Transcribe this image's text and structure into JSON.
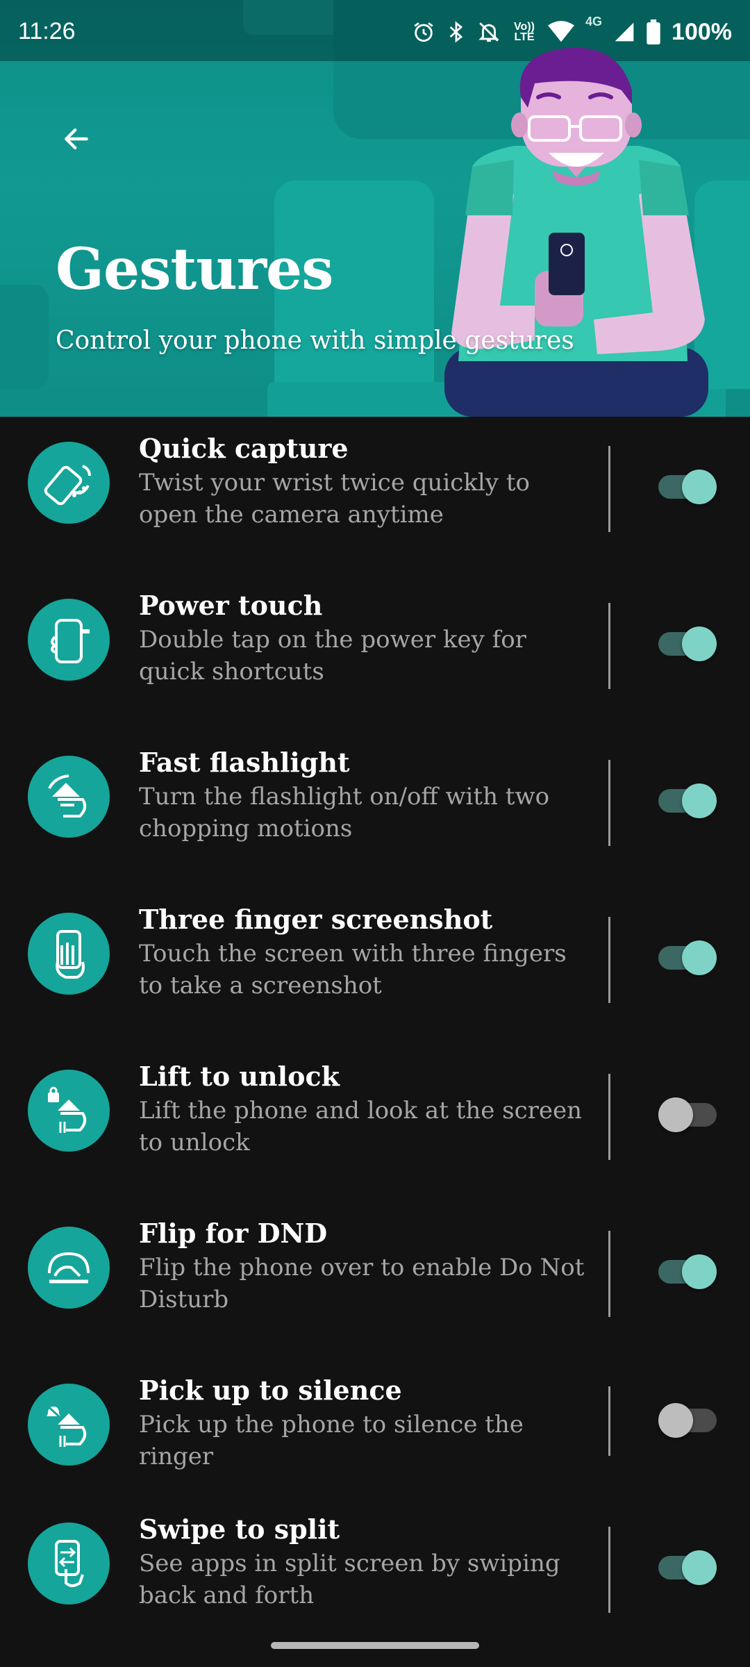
{
  "status": {
    "time": "11:26",
    "volte_label": "Vo)) LTE",
    "network_label": "4G",
    "battery": "100%"
  },
  "header": {
    "title": "Gestures",
    "subtitle": "Control your phone with simple gestures"
  },
  "colors": {
    "accent": "#16a59a",
    "banner": "#109a92",
    "background": "#121212",
    "toggle_on_thumb": "#7fd3c6",
    "toggle_on_track": "#3c6863",
    "toggle_off_thumb": "#bdbdbd",
    "toggle_off_track": "#4b4b4b"
  },
  "gestures": [
    {
      "title": "Quick capture",
      "description": "Twist your wrist twice quickly to open the camera anytime",
      "enabled": true,
      "icon": "quick-capture-icon"
    },
    {
      "title": "Power touch",
      "description": "Double tap on the power key for quick shortcuts",
      "enabled": true,
      "icon": "power-touch-icon"
    },
    {
      "title": "Fast flashlight",
      "description": "Turn the flashlight on/off with two chopping motions",
      "enabled": true,
      "icon": "fast-flashlight-icon"
    },
    {
      "title": "Three finger screenshot",
      "description": "Touch the screen with three fingers to take a screenshot",
      "enabled": true,
      "icon": "three-finger-screenshot-icon"
    },
    {
      "title": "Lift to unlock",
      "description": "Lift the phone and look at the screen to unlock",
      "enabled": false,
      "icon": "lift-to-unlock-icon"
    },
    {
      "title": "Flip for DND",
      "description": "Flip the phone over to enable Do Not Disturb",
      "enabled": true,
      "icon": "flip-for-dnd-icon"
    },
    {
      "title": "Pick up to silence",
      "description": "Pick up the phone to silence the ringer",
      "enabled": false,
      "icon": "pick-up-to-silence-icon"
    },
    {
      "title": "Swipe to split",
      "description": "See apps in split screen by swiping back and forth",
      "enabled": true,
      "icon": "swipe-to-split-icon"
    }
  ]
}
